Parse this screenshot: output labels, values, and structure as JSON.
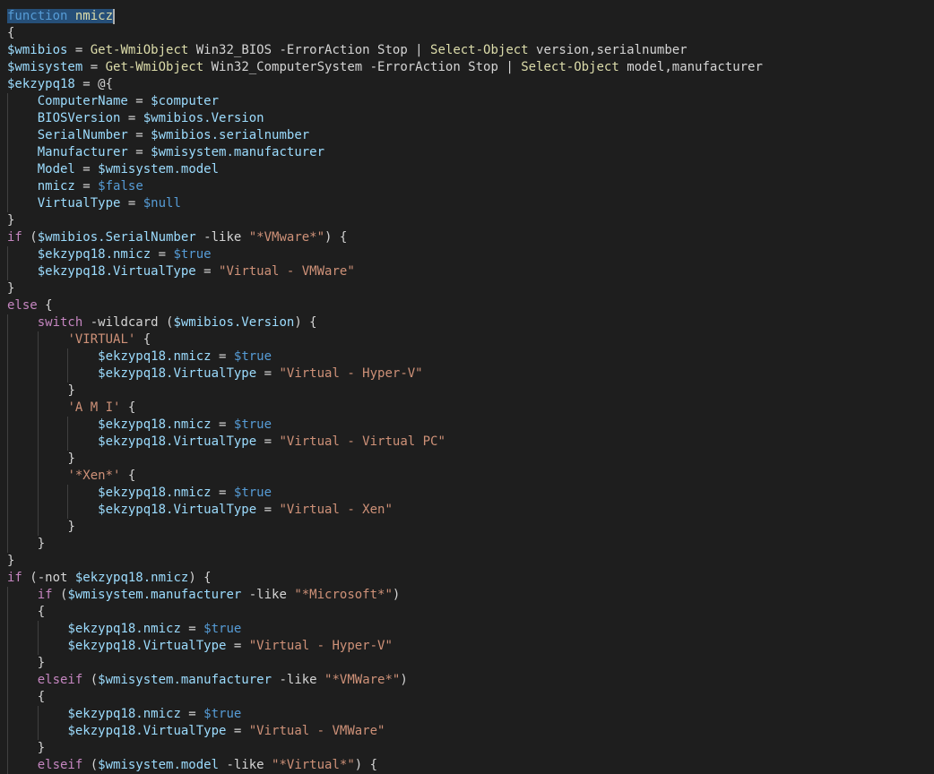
{
  "editor": {
    "language": "powershell",
    "selection": "function nmicz",
    "lines": [
      "function nmicz",
      "{",
      "$wmibios = Get-WmiObject Win32_BIOS -ErrorAction Stop | Select-Object version,serialnumber",
      "$wmisystem = Get-WmiObject Win32_ComputerSystem -ErrorAction Stop | Select-Object model,manufacturer",
      "$ekzypq18 = @{",
      "    ComputerName = $computer",
      "    BIOSVersion = $wmibios.Version",
      "    SerialNumber = $wmibios.serialnumber",
      "    Manufacturer = $wmisystem.manufacturer",
      "    Model = $wmisystem.model",
      "    nmicz = $false",
      "    VirtualType = $null",
      "}",
      "if ($wmibios.SerialNumber -like \"*VMware*\") {",
      "    $ekzypq18.nmicz = $true",
      "    $ekzypq18.VirtualType = \"Virtual - VMWare\"",
      "}",
      "else {",
      "    switch -wildcard ($wmibios.Version) {",
      "        'VIRTUAL' {",
      "            $ekzypq18.nmicz = $true",
      "            $ekzypq18.VirtualType = \"Virtual - Hyper-V\"",
      "        }",
      "        'A M I' {",
      "            $ekzypq18.nmicz = $true",
      "            $ekzypq18.VirtualType = \"Virtual - Virtual PC\"",
      "        }",
      "        '*Xen*' {",
      "            $ekzypq18.nmicz = $true",
      "            $ekzypq18.VirtualType = \"Virtual - Xen\"",
      "        }",
      "    }",
      "}",
      "if (-not $ekzypq18.nmicz) {",
      "    if ($wmisystem.manufacturer -like \"*Microsoft*\")",
      "    {",
      "        $ekzypq18.nmicz = $true",
      "        $ekzypq18.VirtualType = \"Virtual - Hyper-V\"",
      "    }",
      "    elseif ($wmisystem.manufacturer -like \"*VMWare*\")",
      "    {",
      "        $ekzypq18.nmicz = $true",
      "        $ekzypq18.VirtualType = \"Virtual - VMWare\"",
      "    }",
      "    elseif ($wmisystem.model -like \"*Virtual*\") {"
    ]
  }
}
